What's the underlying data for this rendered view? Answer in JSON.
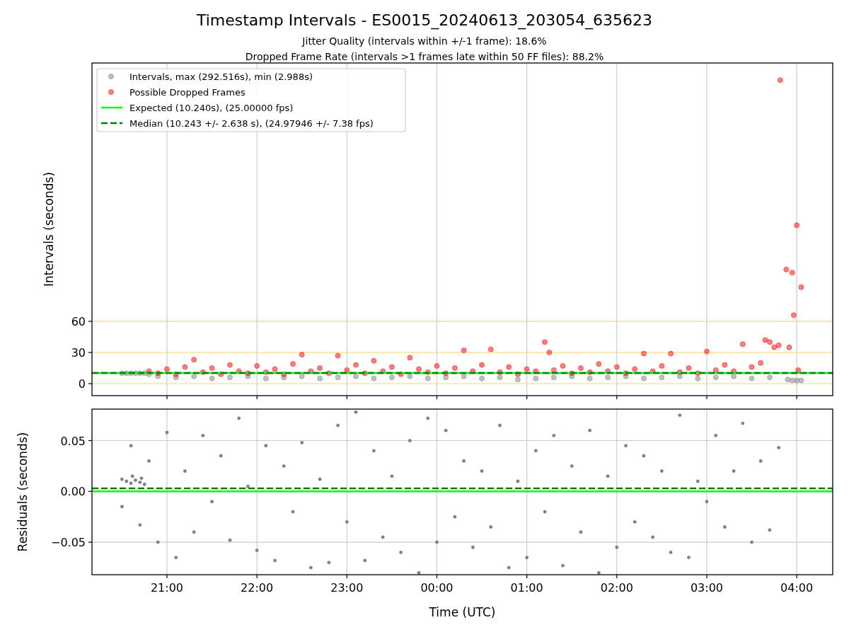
{
  "figure": {
    "title": "Timestamp Intervals - ES0015_20240613_203054_635623",
    "subtitles": [
      "Jitter Quality (intervals within +/-1 frame): 18.6%",
      "Dropped Frame Rate (intervals >1 frames late within 50 FF files): 88.2%"
    ]
  },
  "panels": [
    {
      "chart_data": {
        "type": "scatter",
        "ylabel": "Intervals (seconds)",
        "grid": true,
        "xlim": [
          "2024-06-13T20:10",
          "2024-06-14T04:24"
        ],
        "ylim": [
          -11.6,
          309
        ],
        "yticks": [
          {
            "value": 0,
            "label": "0"
          },
          {
            "value": 30,
            "label": "30"
          },
          {
            "value": 60,
            "label": "60"
          }
        ],
        "series": [
          {
            "name": "Intervals, max (292.516s), min (2.988s)",
            "color": "#808080",
            "x": [
              "2024-06-13T20:30",
              "2024-06-13T20:33",
              "2024-06-13T20:36",
              "2024-06-13T20:39",
              "2024-06-13T20:42",
              "2024-06-13T20:45",
              "2024-06-13T20:48",
              "2024-06-13T20:54",
              "2024-06-13T21:06",
              "2024-06-13T21:18",
              "2024-06-13T21:30",
              "2024-06-13T21:42",
              "2024-06-13T21:54",
              "2024-06-13T22:06",
              "2024-06-13T22:18",
              "2024-06-13T22:30",
              "2024-06-13T22:42",
              "2024-06-13T22:54",
              "2024-06-13T23:06",
              "2024-06-13T23:18",
              "2024-06-13T23:30",
              "2024-06-13T23:42",
              "2024-06-13T23:54",
              "2024-06-14T00:06",
              "2024-06-14T00:18",
              "2024-06-14T00:30",
              "2024-06-14T00:42",
              "2024-06-14T00:54",
              "2024-06-14T01:06",
              "2024-06-14T01:18",
              "2024-06-14T01:30",
              "2024-06-14T01:42",
              "2024-06-14T01:54",
              "2024-06-14T02:06",
              "2024-06-14T02:18",
              "2024-06-14T02:30",
              "2024-06-14T02:42",
              "2024-06-14T02:54",
              "2024-06-14T03:06",
              "2024-06-14T03:18",
              "2024-06-14T03:30",
              "2024-06-14T03:42",
              "2024-06-14T03:54",
              "2024-06-14T03:57",
              "2024-06-14T04:00",
              "2024-06-14T04:03"
            ],
            "values": [
              10,
              10,
              10,
              10,
              10,
              10,
              9,
              7,
              6,
              7,
              5,
              6,
              7,
              5,
              6,
              7,
              5,
              6,
              7,
              5,
              6,
              7,
              5,
              6,
              7,
              5,
              6,
              4,
              5,
              6,
              7,
              5,
              6,
              7,
              5,
              6,
              7,
              5,
              6,
              7,
              5,
              6,
              4,
              3,
              3,
              3
            ]
          },
          {
            "name": "Possible Dropped Frames",
            "color": "#ff0000",
            "x": [
              "2024-06-13T20:48",
              "2024-06-13T20:54",
              "2024-06-13T21:00",
              "2024-06-13T21:06",
              "2024-06-13T21:12",
              "2024-06-13T21:18",
              "2024-06-13T21:24",
              "2024-06-13T21:30",
              "2024-06-13T21:36",
              "2024-06-13T21:42",
              "2024-06-13T21:48",
              "2024-06-13T21:54",
              "2024-06-13T22:00",
              "2024-06-13T22:06",
              "2024-06-13T22:12",
              "2024-06-13T22:18",
              "2024-06-13T22:24",
              "2024-06-13T22:30",
              "2024-06-13T22:36",
              "2024-06-13T22:42",
              "2024-06-13T22:48",
              "2024-06-13T22:54",
              "2024-06-13T23:00",
              "2024-06-13T23:06",
              "2024-06-13T23:12",
              "2024-06-13T23:18",
              "2024-06-13T23:24",
              "2024-06-13T23:30",
              "2024-06-13T23:36",
              "2024-06-13T23:42",
              "2024-06-13T23:48",
              "2024-06-13T23:54",
              "2024-06-14T00:00",
              "2024-06-14T00:06",
              "2024-06-14T00:12",
              "2024-06-14T00:18",
              "2024-06-14T00:24",
              "2024-06-14T00:30",
              "2024-06-14T00:36",
              "2024-06-14T00:42",
              "2024-06-14T00:48",
              "2024-06-14T00:54",
              "2024-06-14T01:00",
              "2024-06-14T01:06",
              "2024-06-14T01:12",
              "2024-06-14T01:15",
              "2024-06-14T01:18",
              "2024-06-14T01:24",
              "2024-06-14T01:30",
              "2024-06-14T01:36",
              "2024-06-14T01:42",
              "2024-06-14T01:48",
              "2024-06-14T01:54",
              "2024-06-14T02:00",
              "2024-06-14T02:06",
              "2024-06-14T02:12",
              "2024-06-14T02:18",
              "2024-06-14T02:24",
              "2024-06-14T02:30",
              "2024-06-14T02:36",
              "2024-06-14T02:42",
              "2024-06-14T02:48",
              "2024-06-14T02:54",
              "2024-06-14T03:00",
              "2024-06-14T03:06",
              "2024-06-14T03:12",
              "2024-06-14T03:18",
              "2024-06-14T03:24",
              "2024-06-14T03:30",
              "2024-06-14T03:36",
              "2024-06-14T03:39",
              "2024-06-14T03:42",
              "2024-06-14T03:45",
              "2024-06-14T03:48",
              "2024-06-14T03:49",
              "2024-06-14T03:53",
              "2024-06-14T03:55",
              "2024-06-14T03:57",
              "2024-06-14T03:58",
              "2024-06-14T04:00",
              "2024-06-14T04:01",
              "2024-06-14T04:03"
            ],
            "values": [
              12,
              10,
              14,
              9,
              16,
              23,
              11,
              15,
              9,
              18,
              12,
              10,
              17,
              11,
              14,
              9,
              19,
              28,
              12,
              15,
              10,
              27,
              13,
              18,
              10,
              22,
              12,
              16,
              9,
              25,
              14,
              11,
              17,
              10,
              15,
              32,
              12,
              18,
              33,
              11,
              16,
              9,
              14,
              12,
              40,
              30,
              13,
              17,
              10,
              15,
              11,
              19,
              12,
              16,
              10,
              14,
              29,
              12,
              17,
              29,
              11,
              15,
              10,
              31,
              13,
              18,
              12,
              38,
              16,
              20,
              42,
              40,
              35,
              37,
              292.5,
              110,
              35,
              107,
              66,
              152.7,
              13,
              93
            ]
          }
        ],
        "ref_lines": [
          {
            "axis": "y",
            "value": 10.24,
            "label": "Expected (10.240s), (25.00000 fps)",
            "color": "#00ff00"
          },
          {
            "axis": "y",
            "value": 10.243,
            "label": "Median (10.243 +/- 2.638 s), (24.97946 +/- 7.38 fps)",
            "color": "#008000"
          }
        ],
        "legend": true
      }
    },
    {
      "chart_data": {
        "type": "scatter",
        "ylabel": "Residuals (seconds)",
        "xlabel": "Time (UTC)",
        "grid": true,
        "xlim": [
          "2024-06-13T20:10",
          "2024-06-14T04:24"
        ],
        "ylim": [
          -0.082,
          0.081
        ],
        "xticks": [
          {
            "value": "2024-06-13T21:00",
            "label": "21:00"
          },
          {
            "value": "2024-06-13T22:00",
            "label": "22:00"
          },
          {
            "value": "2024-06-13T23:00",
            "label": "23:00"
          },
          {
            "value": "2024-06-14T00:00",
            "label": "00:00"
          },
          {
            "value": "2024-06-14T01:00",
            "label": "01:00"
          },
          {
            "value": "2024-06-14T02:00",
            "label": "02:00"
          },
          {
            "value": "2024-06-14T03:00",
            "label": "03:00"
          },
          {
            "value": "2024-06-14T04:00",
            "label": "04:00"
          }
        ],
        "yticks": [
          {
            "value": -0.05,
            "label": "−0.05"
          },
          {
            "value": 0,
            "label": "0.00"
          },
          {
            "value": 0.05,
            "label": "0.05"
          }
        ],
        "series": [
          {
            "color": "#7f7f7f",
            "x": [
              "2024-06-13T20:30",
              "2024-06-13T20:33",
              "2024-06-13T20:36",
              "2024-06-13T20:37",
              "2024-06-13T20:39",
              "2024-06-13T20:42",
              "2024-06-13T20:43",
              "2024-06-13T20:45",
              "2024-06-13T20:30",
              "2024-06-13T20:36",
              "2024-06-13T20:42",
              "2024-06-13T20:48",
              "2024-06-13T20:54",
              "2024-06-13T21:00",
              "2024-06-13T21:06",
              "2024-06-13T21:12",
              "2024-06-13T21:18",
              "2024-06-13T21:24",
              "2024-06-13T21:30",
              "2024-06-13T21:36",
              "2024-06-13T21:42",
              "2024-06-13T21:48",
              "2024-06-13T21:54",
              "2024-06-13T22:00",
              "2024-06-13T22:06",
              "2024-06-13T22:12",
              "2024-06-13T22:18",
              "2024-06-13T22:24",
              "2024-06-13T22:30",
              "2024-06-13T22:36",
              "2024-06-13T22:42",
              "2024-06-13T22:48",
              "2024-06-13T22:54",
              "2024-06-13T23:00",
              "2024-06-13T23:06",
              "2024-06-13T23:12",
              "2024-06-13T23:18",
              "2024-06-13T23:24",
              "2024-06-13T23:30",
              "2024-06-13T23:36",
              "2024-06-13T23:42",
              "2024-06-13T23:48",
              "2024-06-13T23:54",
              "2024-06-14T00:00",
              "2024-06-14T00:06",
              "2024-06-14T00:12",
              "2024-06-14T00:18",
              "2024-06-14T00:24",
              "2024-06-14T00:30",
              "2024-06-14T00:36",
              "2024-06-14T00:42",
              "2024-06-14T00:48",
              "2024-06-14T00:54",
              "2024-06-14T01:00",
              "2024-06-14T01:06",
              "2024-06-14T01:12",
              "2024-06-14T01:18",
              "2024-06-14T01:24",
              "2024-06-14T01:30",
              "2024-06-14T01:36",
              "2024-06-14T01:42",
              "2024-06-14T01:48",
              "2024-06-14T01:54",
              "2024-06-14T02:00",
              "2024-06-14T02:06",
              "2024-06-14T02:12",
              "2024-06-14T02:18",
              "2024-06-14T02:24",
              "2024-06-14T02:30",
              "2024-06-14T02:36",
              "2024-06-14T02:42",
              "2024-06-14T02:48",
              "2024-06-14T02:54",
              "2024-06-14T03:00",
              "2024-06-14T03:06",
              "2024-06-14T03:12",
              "2024-06-14T03:18",
              "2024-06-14T03:24",
              "2024-06-14T03:30",
              "2024-06-14T03:36",
              "2024-06-14T03:42",
              "2024-06-14T03:48"
            ],
            "values": [
              0.012,
              0.01,
              0.008,
              0.015,
              0.011,
              0.009,
              0.013,
              0.007,
              -0.015,
              0.045,
              -0.033,
              0.03,
              -0.05,
              0.058,
              -0.065,
              0.02,
              -0.04,
              0.055,
              -0.01,
              0.035,
              -0.048,
              0.072,
              0.005,
              -0.058,
              0.045,
              -0.068,
              0.025,
              -0.02,
              0.048,
              -0.075,
              0.012,
              -0.07,
              0.065,
              -0.03,
              0.078,
              -0.068,
              0.04,
              -0.045,
              0.015,
              -0.06,
              0.05,
              -0.08,
              0.072,
              -0.05,
              0.06,
              -0.025,
              0.03,
              -0.055,
              0.02,
              -0.035,
              0.065,
              -0.075,
              0.01,
              -0.065,
              0.04,
              -0.02,
              0.055,
              -0.073,
              0.025,
              -0.04,
              0.06,
              -0.08,
              0.015,
              -0.055,
              0.045,
              -0.03,
              0.035,
              -0.045,
              0.02,
              -0.06,
              0.075,
              -0.065,
              0.01,
              -0.01,
              0.055,
              -0.035,
              0.02,
              0.067,
              -0.05,
              0.03,
              -0.038,
              0.043
            ]
          }
        ],
        "ref_lines": [
          {
            "axis": "y",
            "value": 0,
            "color": "#00ff00"
          },
          {
            "axis": "y",
            "value": 0.003,
            "color": "#008000"
          }
        ]
      }
    }
  ]
}
